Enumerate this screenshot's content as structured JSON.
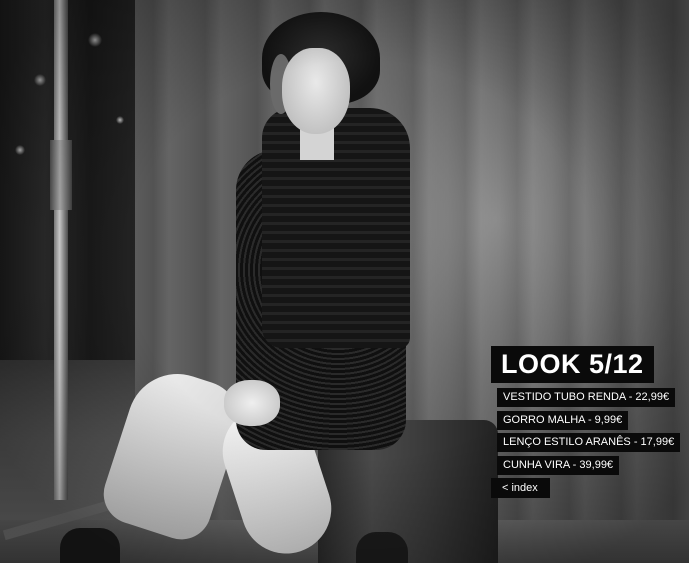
{
  "look": {
    "title": "LOOK 5/12"
  },
  "items": [
    {
      "label": "VESTIDO TUBO RENDA - 22,99€"
    },
    {
      "label": "GORRO MALHA - 9,99€"
    },
    {
      "label": "LENÇO ESTILO ARANÊS - 17,99€"
    },
    {
      "label": "CUNHA VIRA - 39,99€"
    }
  ],
  "nav": {
    "index_label": "< index"
  },
  "colors": {
    "label_bg": "#0a0a0a",
    "label_text": "#ffffff"
  }
}
